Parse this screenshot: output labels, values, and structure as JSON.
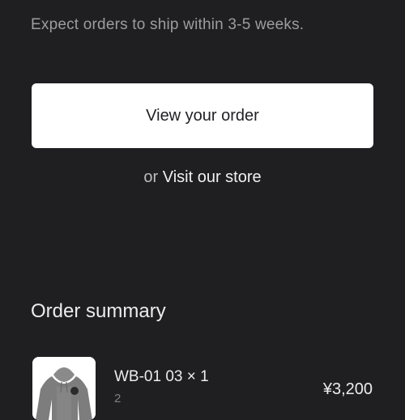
{
  "shipping": {
    "note": "Expect orders to ship within 3-5 weeks."
  },
  "actions": {
    "view_order_label": "View your order",
    "or_text": "or",
    "visit_store_label": "Visit our store"
  },
  "summary": {
    "title": "Order summary",
    "items": [
      {
        "name": "WB-01 03 × 1",
        "variant": "2",
        "price": "¥3,200",
        "image": "gray-hoodie-thumbnail"
      }
    ]
  },
  "colors": {
    "background": "#1f1f22",
    "button_bg": "#ffffff",
    "muted_text": "#9c9ca1"
  }
}
